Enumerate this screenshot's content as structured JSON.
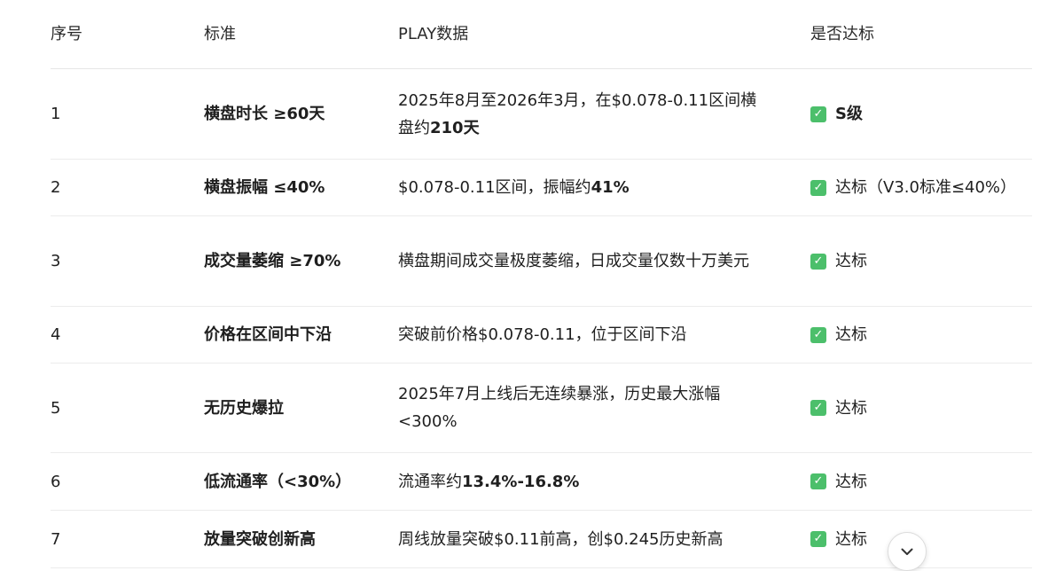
{
  "table": {
    "headers": {
      "num": "序号",
      "standard": "标准",
      "data": "PLAY数据",
      "met": "是否达标"
    },
    "rows": [
      {
        "num": "1",
        "standard": "横盘时长 ≥60天",
        "data_plain": "2025年8月至2026年3月，在$0.078-0.11区间横盘约",
        "data_bold": "210天",
        "data_tail": "",
        "met": "S级",
        "met_bold": true
      },
      {
        "num": "2",
        "standard": "横盘振幅 ≤40%",
        "data_plain": "$0.078-0.11区间，振幅约",
        "data_bold": "41%",
        "data_tail": "",
        "met": "达标（V3.0标准≤40%）",
        "met_bold": false
      },
      {
        "num": "3",
        "standard": "成交量萎缩 ≥70%",
        "data_plain": "横盘期间成交量极度萎缩，日成交量仅数十万美元",
        "data_bold": "",
        "data_tail": "",
        "met": "达标",
        "met_bold": false
      },
      {
        "num": "4",
        "standard": "价格在区间中下沿",
        "data_plain": "突破前价格$0.078-0.11，位于区间下沿",
        "data_bold": "",
        "data_tail": "",
        "met": "达标",
        "met_bold": false
      },
      {
        "num": "5",
        "standard": "无历史爆拉",
        "data_plain": "2025年7月上线后无连续暴涨，历史最大涨幅<300%",
        "data_bold": "",
        "data_tail": "",
        "met": "达标",
        "met_bold": false
      },
      {
        "num": "6",
        "standard": "低流通率（<30%）",
        "data_plain": "流通率约",
        "data_bold": "13.4%-16.8%",
        "data_tail": "",
        "met": "达标",
        "met_bold": false
      },
      {
        "num": "7",
        "standard": "放量突破创新高",
        "data_plain": "周线放量突破$0.11前高，创$0.245历史新高",
        "data_bold": "",
        "data_tail": "",
        "met": "达标",
        "met_bold": false
      }
    ]
  },
  "icons": {
    "check": "check-box-icon",
    "scroll": "chevron-down-icon"
  },
  "colors": {
    "check_bg": "#4cbf6b",
    "divider": "#ececec"
  }
}
